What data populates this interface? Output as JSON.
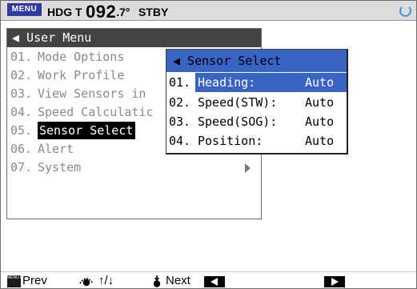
{
  "header": {
    "menu_label": "MENU",
    "hdg_label": "HDG T",
    "hdg_value": "092",
    "hdg_decimal": ".7°",
    "mode": "STBY"
  },
  "user_menu": {
    "title": "◀ User Menu",
    "items": [
      {
        "num": "01.",
        "label": "Mode Options"
      },
      {
        "num": "02.",
        "label": "Work Profile"
      },
      {
        "num": "03.",
        "label": "View Sensors in"
      },
      {
        "num": "04.",
        "label": "Speed Calculatic"
      },
      {
        "num": "05.",
        "label": "Sensor Select"
      },
      {
        "num": "06.",
        "label": "Alert"
      },
      {
        "num": "07.",
        "label": "System"
      }
    ]
  },
  "sensor_menu": {
    "title": "◀ Sensor Select",
    "items": [
      {
        "num": "01.",
        "label": "Heading:",
        "value": "Auto"
      },
      {
        "num": "02.",
        "label": "Speed(STW):",
        "value": "Auto"
      },
      {
        "num": "03.",
        "label": "Speed(SOG):",
        "value": "Auto"
      },
      {
        "num": "04.",
        "label": "Position:",
        "value": "Auto"
      }
    ]
  },
  "footer": {
    "prev_label": "Prev",
    "nav_label": "↑/↓",
    "next_label": "Next",
    "menu_icon_text": "MENU ESC"
  },
  "colors": {
    "menu_button": "#2f3aa4",
    "highlight": "#3a64c4",
    "title_bar": "#434343"
  }
}
